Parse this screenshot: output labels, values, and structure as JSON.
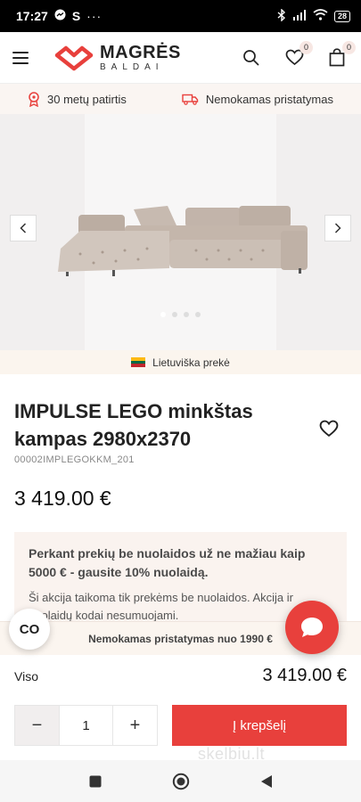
{
  "status_bar": {
    "time": "17:27",
    "extra": "S",
    "dots": "···",
    "battery": "28"
  },
  "header": {
    "logo_main": "MAGRĖS",
    "logo_sub": "BALDAI",
    "wishlist_count": "0",
    "cart_count": "0"
  },
  "perks": [
    {
      "label": "30 metų patirtis",
      "icon": "award-icon"
    },
    {
      "label": "Nemokamas pristatymas",
      "icon": "truck-icon"
    }
  ],
  "gallery": {
    "slide_count": 4,
    "active_slide": 1,
    "origin_label": "Lietuviška prekė"
  },
  "product": {
    "title": "IMPULSE LEGO minkštas kampas 2980x2370",
    "sku": "00002IMPLEGOKKM_201",
    "price": "3 419.00 €"
  },
  "promo": {
    "title": "Perkant prekių be nuolaidos už ne mažiau kaip 5000 € - gausite 10% nuolaidą.",
    "text": "Ši akcija taikoma tik prekėms be nuolaidos. Akcija ir nuolaidų kodai nesumuojami."
  },
  "floating": {
    "co_label": "CO",
    "shipping_note": "Nemokamas pristatymas nuo 1990 €"
  },
  "cart": {
    "total_label": "Viso",
    "total_value": "3 419.00 €",
    "qty_minus": "−",
    "qty_plus": "+",
    "qty_value": "1",
    "add_label": "Į krepšelį"
  },
  "watermark": "skelbiu.lt",
  "colors": {
    "accent": "#e8403c",
    "cream": "#faf3ef"
  }
}
